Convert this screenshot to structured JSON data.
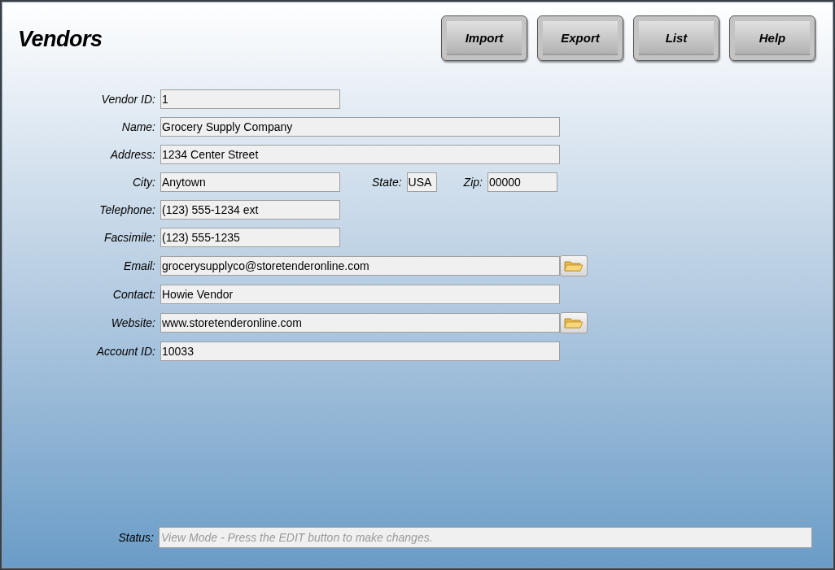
{
  "title": "Vendors",
  "buttons": [
    "Import",
    "Export",
    "List",
    "Help"
  ],
  "fields": [
    {
      "label": "Vendor ID:",
      "value": "1",
      "kind": "short",
      "browse": false
    },
    {
      "label": "Name:",
      "value": "Grocery Supply Company",
      "kind": "long",
      "browse": false
    },
    {
      "label": "Address:",
      "value": "1234 Center Street",
      "kind": "long",
      "browse": false
    },
    {
      "label": "City:",
      "value": "Anytown",
      "kind": "short",
      "browse": false,
      "extras": [
        {
          "label": "State:",
          "value": "USA",
          "kind": "tiny"
        },
        {
          "label": "Zip:",
          "value": "00000",
          "kind": "small"
        }
      ]
    },
    {
      "label": "Telephone:",
      "value": "(123) 555-1234 ext",
      "kind": "short",
      "browse": false
    },
    {
      "label": "Facsimile:",
      "value": "(123) 555-1235",
      "kind": "short",
      "browse": false
    },
    {
      "label": "Email:",
      "value": "grocerysupplyco@storetenderonline.com",
      "kind": "long",
      "browse": true
    },
    {
      "label": "Contact:",
      "value": "Howie Vendor",
      "kind": "long",
      "browse": false
    },
    {
      "label": "Website:",
      "value": "www.storetenderonline.com",
      "kind": "long",
      "browse": true
    },
    {
      "label": "Account ID:",
      "value": "10033",
      "kind": "long",
      "browse": false
    }
  ],
  "status": {
    "label": "Status:",
    "placeholder": "View Mode - Press the EDIT button to make changes."
  }
}
